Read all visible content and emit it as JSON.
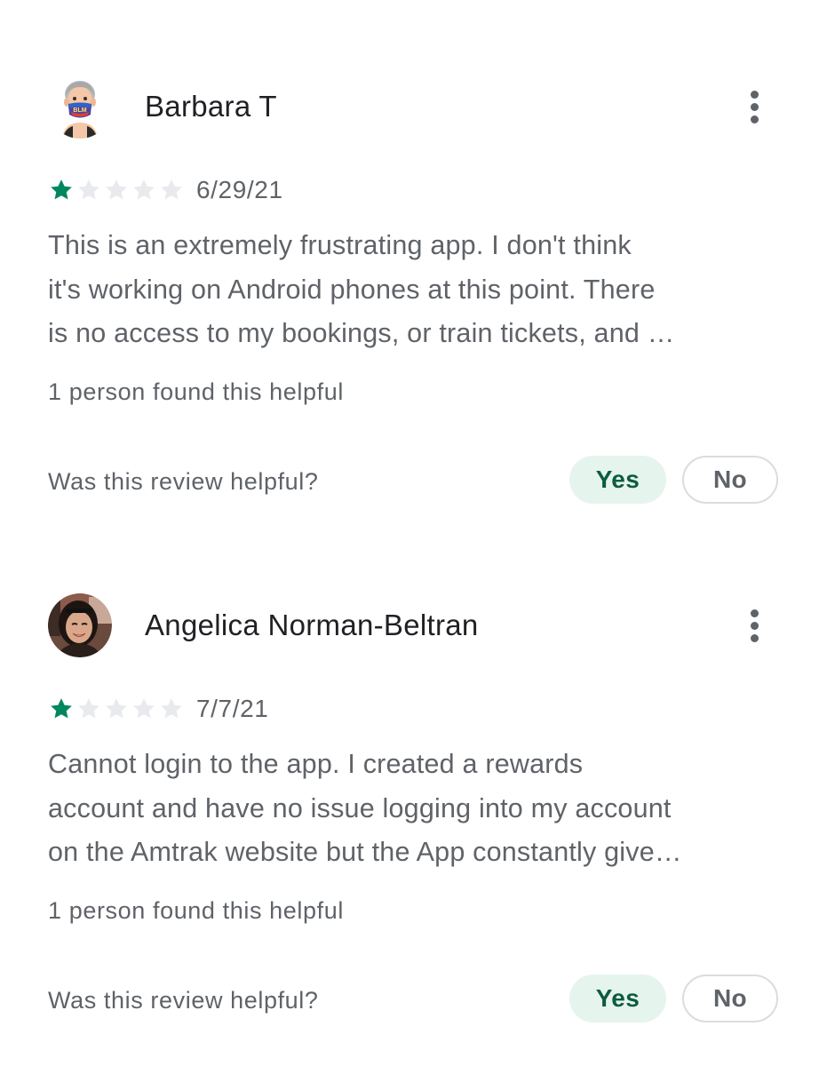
{
  "reviews": [
    {
      "author": "Barbara T",
      "avatar": "memoji-avatar-blm-mask",
      "rating": 1,
      "max_rating": 5,
      "date": "6/29/21",
      "body_lines": [
        "This is an extremely frustrating app. I don't think",
        "it's working on Android phones at this point. There",
        "is no access to my bookings, or train tickets, and …"
      ],
      "helpful_count_text": "1 person found this helpful",
      "helpful_question": "Was this review helpful?",
      "yes_label": "Yes",
      "no_label": "No"
    },
    {
      "author": "Angelica Norman-Beltran",
      "avatar": "photo-avatar",
      "rating": 1,
      "max_rating": 5,
      "date": "7/7/21",
      "body_lines": [
        "Cannot login to the app. I created a rewards",
        "account and have no issue logging into my account",
        "on the Amtrak website but the App constantly give…"
      ],
      "helpful_count_text": "1 person found this helpful",
      "helpful_question": "Was this review helpful?",
      "yes_label": "Yes",
      "no_label": "No"
    }
  ],
  "icons": {
    "more": "more-vert-icon",
    "star": "star-icon"
  },
  "colors": {
    "star_filled": "#01875f",
    "star_empty": "#e8eaed",
    "yes_bg": "#e6f4ee",
    "yes_text": "#0d5c3f",
    "secondary_text": "#5f6368"
  }
}
